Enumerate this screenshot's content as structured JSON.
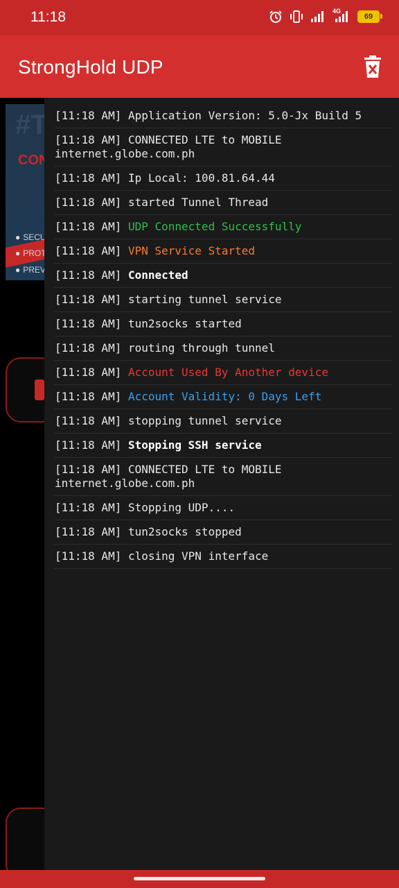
{
  "status_bar": {
    "time": "11:18",
    "network": "4G",
    "battery": "69",
    "icons": [
      "alarm-icon",
      "vibrate-icon",
      "signal-icon",
      "signal-4g-icon",
      "battery-icon"
    ]
  },
  "app_bar": {
    "title": "StrongHold UDP",
    "action_icon": "delete-icon"
  },
  "background": {
    "banner_text": "#T",
    "banner_sub": "CONN",
    "banner_items": [
      "SECU",
      "PROT",
      "PREV"
    ]
  },
  "log": {
    "entries": [
      {
        "time": "[11:18 AM]",
        "msg": "Application Version: 5.0-Jx Build 5",
        "style": ""
      },
      {
        "time": "[11:18 AM]",
        "msg": "CONNECTED LTE to MOBILE internet.globe.com.ph",
        "style": ""
      },
      {
        "time": "[11:18 AM]",
        "msg": "Ip Local: 100.81.64.44",
        "style": ""
      },
      {
        "time": "[11:18 AM]",
        "msg": "started Tunnel Thread",
        "style": ""
      },
      {
        "time": "[11:18 AM]",
        "msg": "UDP Connected Successfully",
        "style": "green"
      },
      {
        "time": "[11:18 AM]",
        "msg": "VPN Service Started",
        "style": "orange"
      },
      {
        "time": "[11:18 AM]",
        "msg": "Connected",
        "style": "bold"
      },
      {
        "time": "[11:18 AM]",
        "msg": "starting tunnel service",
        "style": ""
      },
      {
        "time": "[11:18 AM]",
        "msg": "tun2socks started",
        "style": ""
      },
      {
        "time": "[11:18 AM]",
        "msg": "routing through tunnel",
        "style": ""
      },
      {
        "time": "[11:18 AM]",
        "msg": "Account Used By Another device",
        "style": "red"
      },
      {
        "time": "[11:18 AM]",
        "msg": "Account Validity: 0 Days Left",
        "style": "blue"
      },
      {
        "time": "[11:18 AM]",
        "msg": "stopping tunnel service",
        "style": ""
      },
      {
        "time": "[11:18 AM]",
        "msg": "Stopping SSH service",
        "style": "bold"
      },
      {
        "time": "[11:18 AM]",
        "msg": "CONNECTED LTE to MOBILE internet.globe.com.ph",
        "style": ""
      },
      {
        "time": "[11:18 AM]",
        "msg": "Stopping UDP....",
        "style": ""
      },
      {
        "time": "[11:18 AM]",
        "msg": "tun2socks stopped",
        "style": ""
      },
      {
        "time": "[11:18 AM]",
        "msg": "closing VPN interface",
        "style": ""
      }
    ]
  },
  "colors": {
    "app_bar": "#d32f2f",
    "status_bar": "#c62828",
    "drawer_bg": "#1a1a1a",
    "success": "#2fbf4a",
    "warning": "#f57c33",
    "error": "#e53935",
    "info": "#3aa0f0"
  }
}
